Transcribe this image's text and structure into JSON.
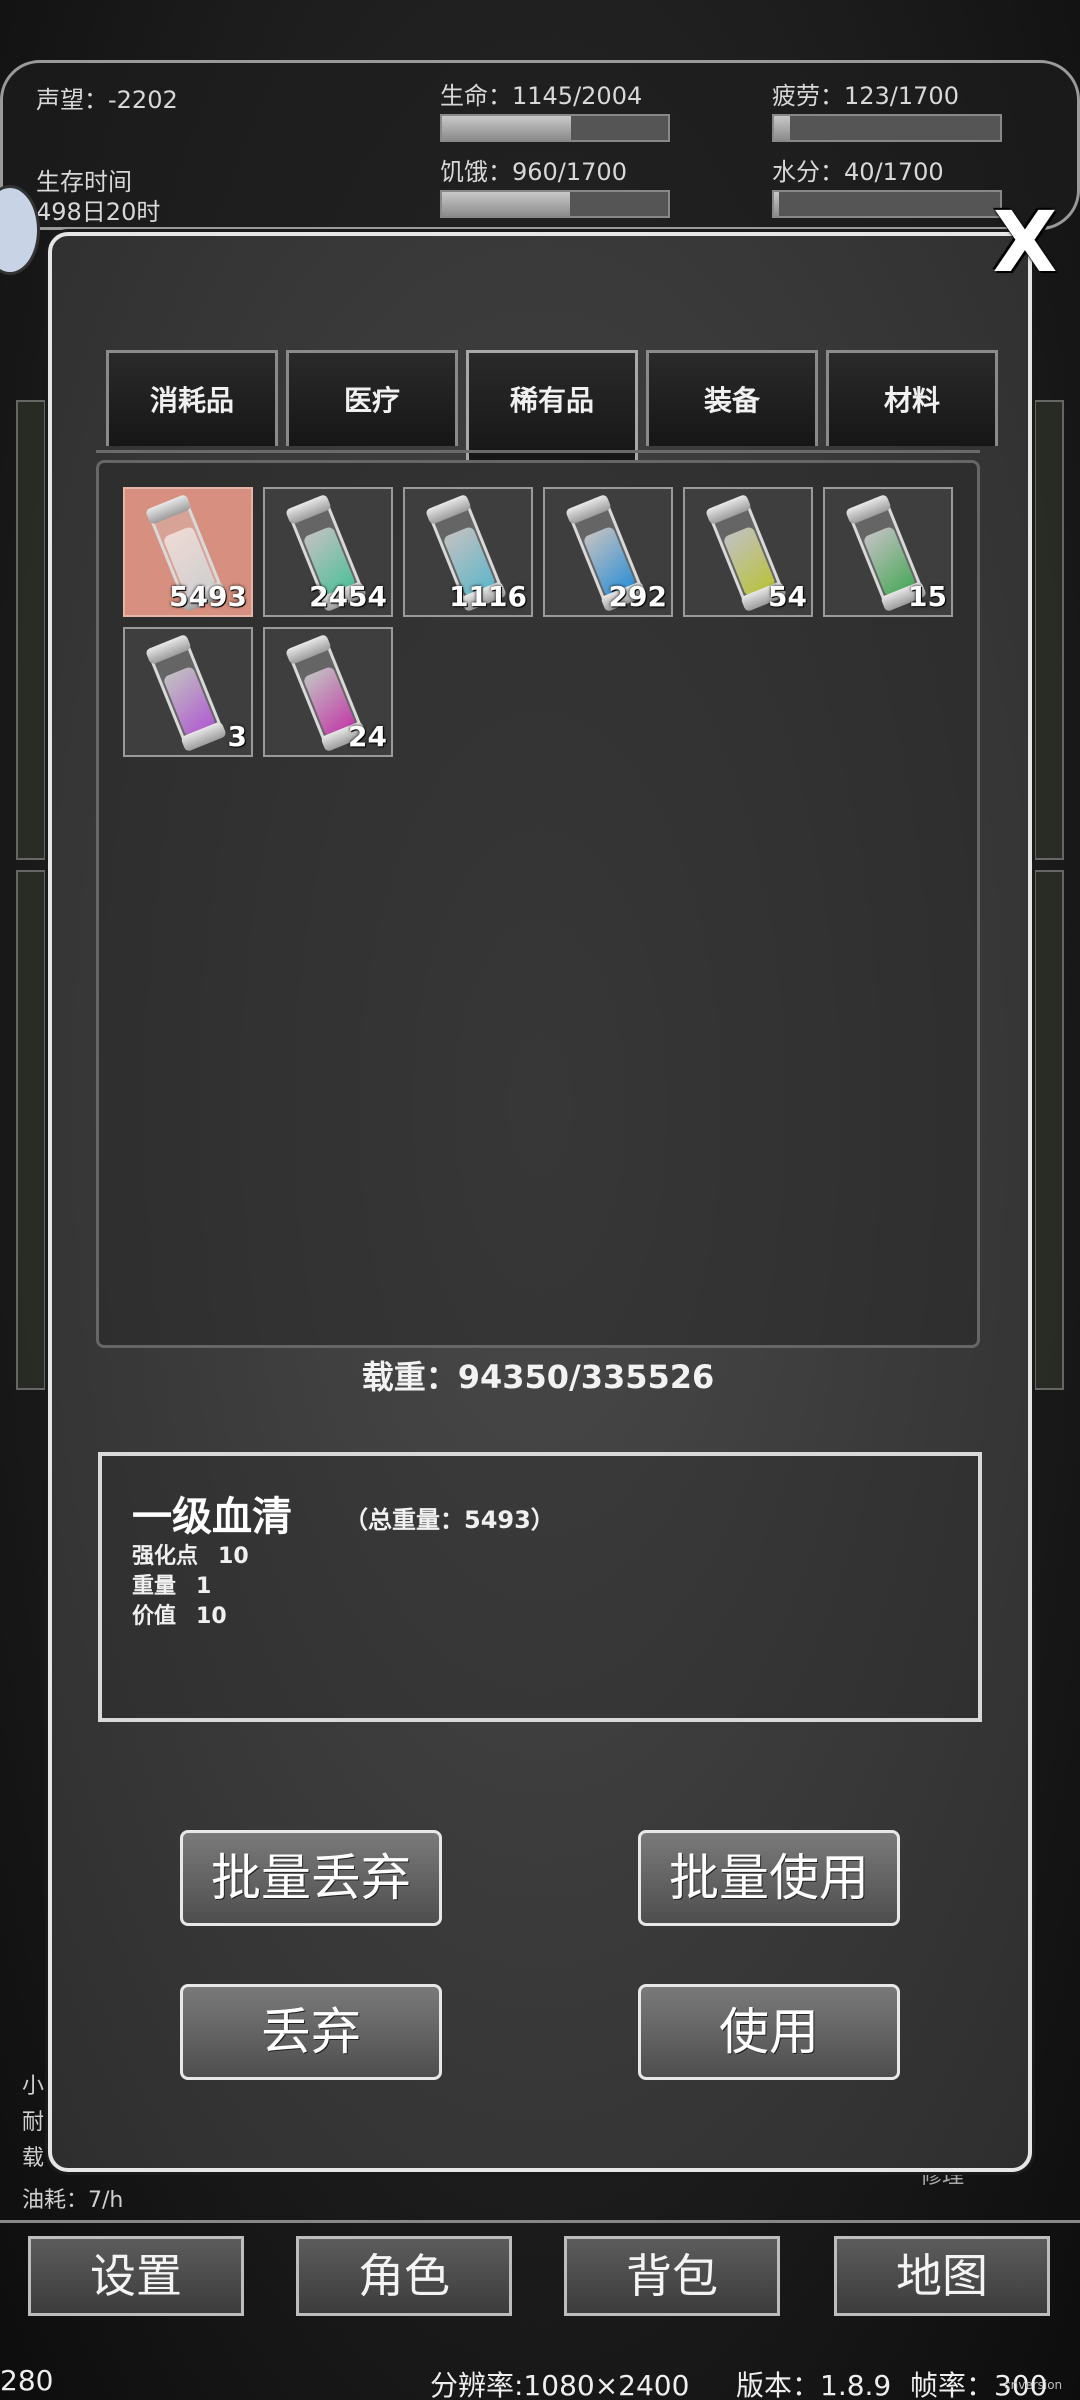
{
  "hud": {
    "reputation": "声望：-2202",
    "survival_label": "生存时间",
    "survival_value": "498日20时",
    "health": "生命：1145/2004",
    "fatigue": "疲劳：123/1700",
    "hunger": "饥饿：960/1700",
    "water": "水分：40/1700",
    "health_frac": 0.571,
    "fatigue_frac": 0.072,
    "hunger_frac": 0.565,
    "water_frac": 0.024
  },
  "background_panel": {
    "line1": "小",
    "line2": "耐",
    "line3": "载",
    "fuel": "油耗：7/h",
    "repair": "修理"
  },
  "nav": {
    "settings": "设置",
    "character": "角色",
    "backpack": "背包",
    "map": "地图"
  },
  "footer": {
    "left": "280",
    "resolution": "分辨率:1080×2400",
    "version": "版本：1.8.9",
    "fps": "帧率：300",
    "watermark": "cnversion"
  },
  "modal": {
    "close": "X",
    "tabs": [
      "消耗品",
      "医疗",
      "稀有品",
      "装备",
      "材料"
    ],
    "items": [
      {
        "qty": "5493",
        "color": "#cfcfcf"
      },
      {
        "qty": "2454",
        "color": "#4fbf9a"
      },
      {
        "qty": "1116",
        "color": "#5fb6c9"
      },
      {
        "qty": "292",
        "color": "#2f8fd6"
      },
      {
        "qty": "54",
        "color": "#b9c23a"
      },
      {
        "qty": "15",
        "color": "#4aa85a"
      },
      {
        "qty": "3",
        "color": "#b05ad0"
      },
      {
        "qty": "24",
        "color": "#c23aa8"
      }
    ],
    "weight": "载重：94350/335526",
    "detail": {
      "name": "一级血清",
      "total_weight": "（总重量：5493）",
      "attr1_label": "强化点",
      "attr1_value": "10",
      "attr2_label": "重量",
      "attr2_value": "1",
      "attr3_label": "价值",
      "attr3_value": "10"
    },
    "buttons": {
      "batch_drop": "批量丢弃",
      "batch_use": "批量使用",
      "drop": "丢弃",
      "use": "使用"
    }
  }
}
